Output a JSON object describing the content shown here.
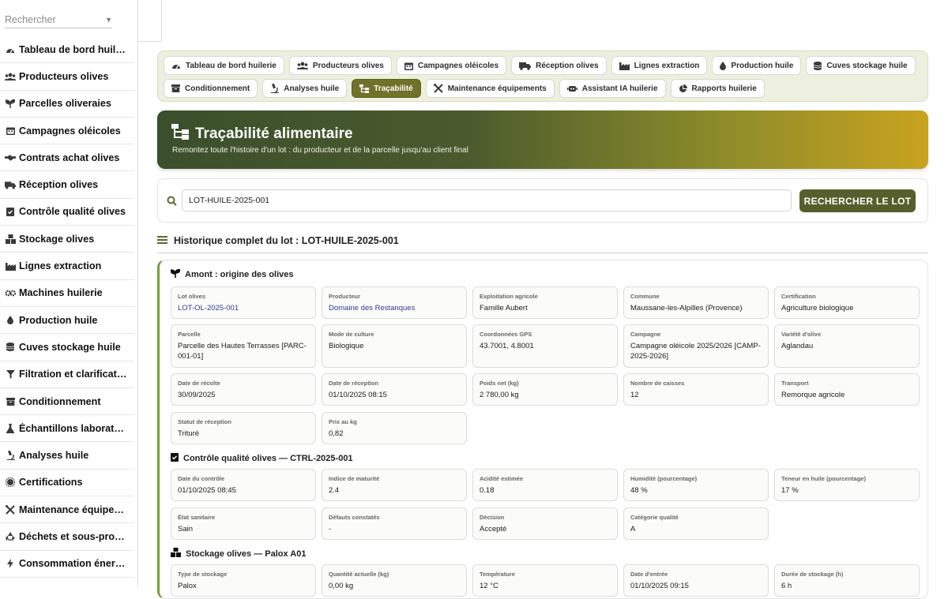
{
  "sidebar": {
    "search_placeholder": "Rechercher",
    "items": [
      {
        "icon": "dashboard-icon",
        "label": "Tableau de bord huile…"
      },
      {
        "icon": "users-icon",
        "label": "Producteurs olives"
      },
      {
        "icon": "seedling-icon",
        "label": "Parcelles oliveraies"
      },
      {
        "icon": "calendar-icon",
        "label": "Campagnes oléicoles"
      },
      {
        "icon": "handshake-icon",
        "label": "Contrats achat olives"
      },
      {
        "icon": "truck-icon",
        "label": "Réception olives"
      },
      {
        "icon": "clipboard-check-icon",
        "label": "Contrôle qualité olives"
      },
      {
        "icon": "boxes-icon",
        "label": "Stockage olives"
      },
      {
        "icon": "industry-icon",
        "label": "Lignes extraction"
      },
      {
        "icon": "cogs-icon",
        "label": "Machines huilerie"
      },
      {
        "icon": "oil-drop-icon",
        "label": "Production huile"
      },
      {
        "icon": "database-icon",
        "label": "Cuves stockage huile"
      },
      {
        "icon": "filter-icon",
        "label": "Filtration et clarificat…"
      },
      {
        "icon": "box-icon",
        "label": "Conditionnement"
      },
      {
        "icon": "flask-icon",
        "label": "Échantillons laborat…"
      },
      {
        "icon": "microscope-icon",
        "label": "Analyses huile"
      },
      {
        "icon": "certificate-icon",
        "label": "Certifications"
      },
      {
        "icon": "tools-icon",
        "label": "Maintenance équipe…"
      },
      {
        "icon": "recycle-icon",
        "label": "Déchets et sous-pro…"
      },
      {
        "icon": "bolt-icon",
        "label": "Consommation éner…"
      }
    ]
  },
  "nav": {
    "row1": [
      {
        "icon": "dashboard-icon",
        "label": "Tableau de bord huilerie",
        "active": false
      },
      {
        "icon": "users-icon",
        "label": "Producteurs olives",
        "active": false
      },
      {
        "icon": "calendar-icon",
        "label": "Campagnes oléicoles",
        "active": false
      },
      {
        "icon": "truck-icon",
        "label": "Réception olives",
        "active": false
      },
      {
        "icon": "industry-icon",
        "label": "Lignes extraction",
        "active": false
      },
      {
        "icon": "oil-drop-icon",
        "label": "Production huile",
        "active": false
      },
      {
        "icon": "database-icon",
        "label": "Cuves stockage huile",
        "active": false
      }
    ],
    "row2": [
      {
        "icon": "box-icon",
        "label": "Conditionnement",
        "active": false
      },
      {
        "icon": "microscope-icon",
        "label": "Analyses huile",
        "active": false
      },
      {
        "icon": "sitemap-icon",
        "label": "Traçabilité",
        "active": true
      },
      {
        "icon": "tools-icon",
        "label": "Maintenance équipements",
        "active": false
      },
      {
        "icon": "robot-icon",
        "label": "Assistant IA huilerie",
        "active": false
      },
      {
        "icon": "chart-pie-icon",
        "label": "Rapports huilerie",
        "active": false
      }
    ]
  },
  "hero": {
    "title": "Traçabilité alimentaire",
    "subtitle": "Remontez toute l'histoire d'un lot : du producteur et de la parcelle jusqu'au client final"
  },
  "search": {
    "value": "LOT-HUILE-2025-001",
    "button_label": "RECHERCHER LE LOT"
  },
  "history": {
    "title": "Historique complet du lot : LOT-HUILE-2025-001"
  },
  "sections": {
    "amont": {
      "title": "Amont : origine des olives",
      "fields": [
        {
          "label": "Lot olives",
          "value": "LOT-OL-2025-001",
          "link": true
        },
        {
          "label": "Producteur",
          "value": "Domaine des Restanques",
          "link": true
        },
        {
          "label": "Exploitation agricole",
          "value": "Famille Aubert"
        },
        {
          "label": "Commune",
          "value": "Maussane-les-Alpilles (Provence)"
        },
        {
          "label": "Certification",
          "value": "Agriculture biologique"
        },
        {
          "label": "Parcelle",
          "value": "Parcelle des Hautes Terrasses [PARC-001-01]"
        },
        {
          "label": "Mode de culture",
          "value": "Biologique"
        },
        {
          "label": "Coordonnées GPS",
          "value": "43.7001, 4.8001"
        },
        {
          "label": "Campagne",
          "value": "Campagne oléicole 2025/2026 [CAMP-2025-2026]"
        },
        {
          "label": "Variété d'olive",
          "value": "Aglandau"
        },
        {
          "label": "Date de récolte",
          "value": "30/09/2025"
        },
        {
          "label": "Date de réception",
          "value": "01/10/2025 08:15"
        },
        {
          "label": "Poids net (kg)",
          "value": "2 780,00 kg"
        },
        {
          "label": "Nombre de caisses",
          "value": "12"
        },
        {
          "label": "Transport",
          "value": "Remorque agricole"
        },
        {
          "label": "Statut de réception",
          "value": "Trituré"
        },
        {
          "label": "Prix au kg",
          "value": "0,82"
        }
      ]
    },
    "controle": {
      "title": "Contrôle qualité olives — CTRL-2025-001",
      "fields": [
        {
          "label": "Date du contrôle",
          "value": "01/10/2025 08:45"
        },
        {
          "label": "Indice de maturité",
          "value": "2.4"
        },
        {
          "label": "Acidité estimée",
          "value": "0.18"
        },
        {
          "label": "Humidité (pourcentage)",
          "value": "48 %"
        },
        {
          "label": "Teneur en huile (pourcentage)",
          "value": "17 %"
        },
        {
          "label": "État sanitaire",
          "value": "Sain"
        },
        {
          "label": "Défauts constatés",
          "value": "-"
        },
        {
          "label": "Décision",
          "value": "Accepté"
        },
        {
          "label": "Catégorie qualité",
          "value": "A"
        }
      ]
    },
    "stockage": {
      "title": "Stockage olives — Palox A01",
      "fields": [
        {
          "label": "Type de stockage",
          "value": "Palox"
        },
        {
          "label": "Quantité actuelle (kg)",
          "value": "0,00 kg"
        },
        {
          "label": "Température",
          "value": "12 °C"
        },
        {
          "label": "Date d'entrée",
          "value": "01/10/2025 09:15"
        },
        {
          "label": "Durée de stockage (h)",
          "value": "6 h"
        }
      ]
    }
  },
  "colors": {
    "accent": "#6f7229",
    "nav_bg": "#eef0df",
    "timeline_border": "#7a9a3a",
    "link": "#2a3d8f"
  }
}
